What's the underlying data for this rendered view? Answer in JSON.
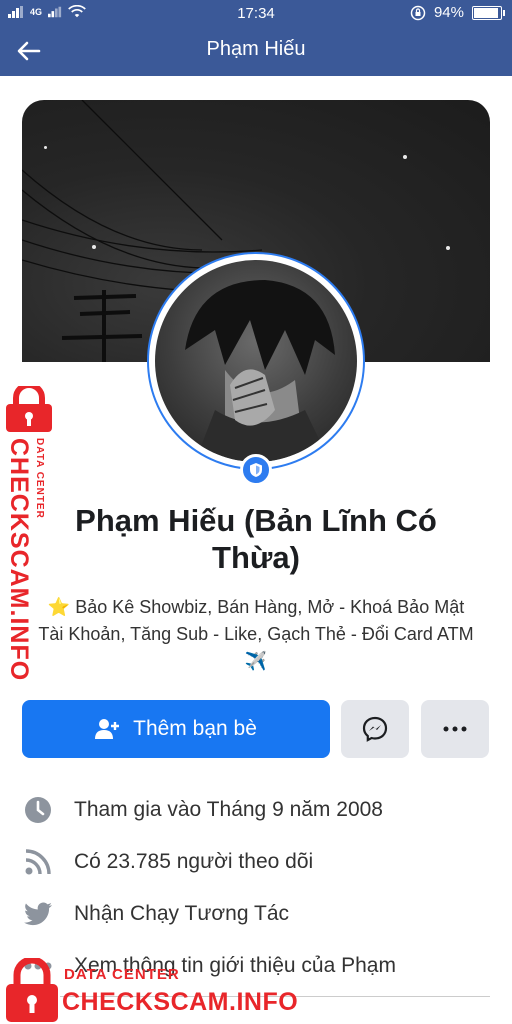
{
  "status_bar": {
    "network": "4G",
    "time": "17:34",
    "battery": "94%",
    "battery_level": 0.94
  },
  "header": {
    "title": "Phạm Hiếu",
    "back_icon": "arrow-left-icon"
  },
  "profile": {
    "name": "Phạm Hiếu (Bản Lĩnh Có Thừa)",
    "bio_line1": "⭐ Bảo Kê Showbiz, Bán Hàng, Mở - Khoá Bảo Mật",
    "bio_line2": "Tài Khoản, Tăng Sub - Like, Gạch Thẻ - Đổi Card ATM",
    "bio_line3": "✈️"
  },
  "actions": {
    "add_friend_label": "Thêm bạn bè",
    "add_friend_icon": "person-add-icon",
    "message_icon": "messenger-icon",
    "more_icon": "more-dots-icon"
  },
  "info": [
    {
      "icon": "clock-icon",
      "text": "Tham gia vào Tháng 9 năm 2008"
    },
    {
      "icon": "rss-icon",
      "text": "Có 23.785 người theo dõi"
    },
    {
      "icon": "twitter-icon",
      "text": "Nhận Chạy Tương Tác"
    },
    {
      "icon": "dots-icon",
      "text": "Xem thông tin giới thiệu của Phạm"
    }
  ],
  "watermark": {
    "title": "CHECKSCAM.INFO",
    "subtitle": "DATA CENTER"
  },
  "colors": {
    "header_bg": "#3b5998",
    "primary_button": "#1877f2",
    "secondary_button": "#e4e6eb",
    "watermark": "#e8262a"
  }
}
